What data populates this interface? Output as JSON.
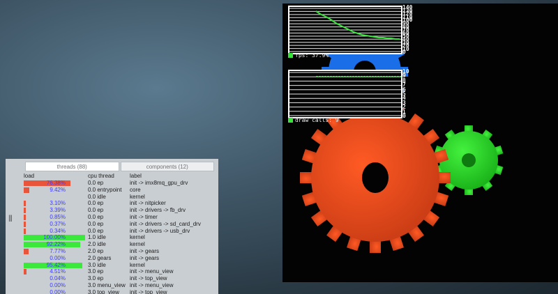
{
  "gears_window": {
    "fps_graph": {
      "scale": [
        "140",
        "130",
        "120",
        "110",
        "100",
        "90",
        "80",
        "70",
        "60",
        "50",
        "40",
        "30",
        "20",
        "10",
        "0"
      ],
      "label": "fps: 37.9%"
    },
    "draw_calls_graph": {
      "scale": [
        "10",
        "9",
        "8",
        "7",
        "6",
        "5",
        "4",
        "3",
        "2",
        "1",
        "0"
      ],
      "label": "draw calls: 9"
    },
    "colors": {
      "red_gear": "#f24a1e",
      "green_gear": "#2de22b",
      "blue_gear": "#1a73f0"
    }
  },
  "top_view": {
    "tabs": [
      "threads (88)",
      "components (12)"
    ],
    "headers": {
      "load": "load",
      "cpu": "cpu thread",
      "label": "label"
    },
    "rows": [
      {
        "load": "76.38%",
        "cpu": "0.0 ep",
        "label": "init -> imx8mq_gpu_drv",
        "fill": 0.76,
        "color": "#e8553a"
      },
      {
        "load": "9.42%",
        "cpu": "0.0 entrypoint",
        "label": "core",
        "fill": 0.094,
        "color": "#e8553a"
      },
      {
        "load": "",
        "cpu": "0.0 idle",
        "label": "kernel",
        "fill": 0.0,
        "color": "#3be83b"
      },
      {
        "load": "3.10%",
        "cpu": "0.0 ep",
        "label": "init -> nitpicker",
        "fill": 0.03,
        "color": "#e8553a"
      },
      {
        "load": "3.39%",
        "cpu": "0.0 ep",
        "label": "init -> drivers -> fb_drv",
        "fill": 0.034,
        "color": "#e8553a"
      },
      {
        "load": "0.85%",
        "cpu": "0.0 ep",
        "label": "init -> timer",
        "fill": 0.0085,
        "color": "#e8553a"
      },
      {
        "load": "0.37%",
        "cpu": "0.0 ep",
        "label": "init -> drivers -> sd_card_drv",
        "fill": 0.004,
        "color": "#e8553a"
      },
      {
        "load": "0.34%",
        "cpu": "0.0 ep",
        "label": "init -> drivers -> usb_drv",
        "fill": 0.003,
        "color": "#e8553a"
      },
      {
        "load": "100.00%",
        "cpu": "1.0 idle",
        "label": "kernel",
        "fill": 1.0,
        "color": "#3be83b"
      },
      {
        "load": "92.22%",
        "cpu": "2.0 idle",
        "label": "kernel",
        "fill": 0.92,
        "color": "#3be83b"
      },
      {
        "load": "7.77%",
        "cpu": "2.0 ep",
        "label": "init -> gears",
        "fill": 0.078,
        "color": "#e8553a"
      },
      {
        "load": "0.00%",
        "cpu": "2.0 gears",
        "label": "init -> gears",
        "fill": 0.0,
        "color": "#e8553a"
      },
      {
        "load": "95.42%",
        "cpu": "3.0 idle",
        "label": "kernel",
        "fill": 0.95,
        "color": "#3be83b"
      },
      {
        "load": "4.51%",
        "cpu": "3.0 ep",
        "label": "init -> menu_view",
        "fill": 0.045,
        "color": "#e8553a"
      },
      {
        "load": "0.04%",
        "cpu": "3.0 ep",
        "label": "init -> top_view",
        "fill": 0.0,
        "color": "#e8553a"
      },
      {
        "load": "0.00%",
        "cpu": "3.0 menu_view",
        "label": "init -> menu_view",
        "fill": 0.0,
        "color": "#e8553a"
      },
      {
        "load": "0.00%",
        "cpu": "3.0 top_view",
        "label": "init -> top_view",
        "fill": 0.0,
        "color": "#e8553a"
      }
    ]
  }
}
